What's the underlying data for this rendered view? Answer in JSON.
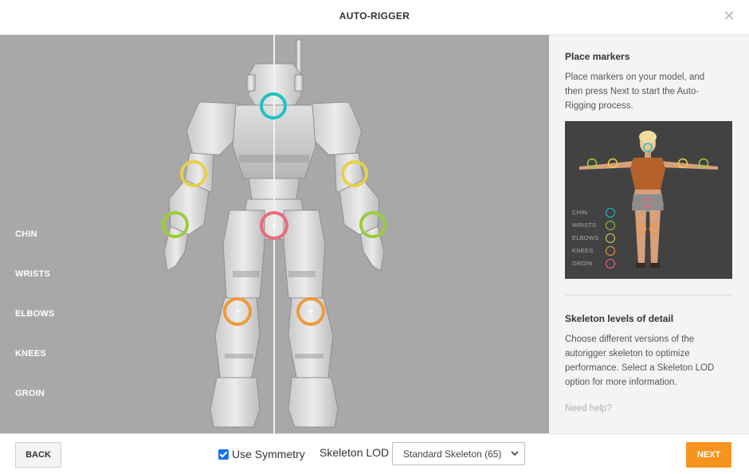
{
  "dialog": {
    "title": "AUTO-RIGGER",
    "close_icon": "close-icon"
  },
  "viewport": {
    "marker_labels": [
      "CHIN",
      "WRISTS",
      "ELBOWS",
      "KNEES",
      "GROIN"
    ],
    "marker_colors": {
      "chin": "#1ec2c4",
      "wrists": "#98cd3a",
      "elbows": "#e6d04a",
      "knees": "#f0993c",
      "groin": "#eb6a7d"
    }
  },
  "panel": {
    "place_markers_title": "Place markers",
    "place_markers_text": "Place markers on your model, and then press Next to start the Auto-Rigging process.",
    "legend": [
      "CHIN",
      "WRISTS",
      "ELBOWS",
      "KNEES",
      "GROIN"
    ],
    "lod_title": "Skeleton levels of detail",
    "lod_text": "Choose different versions of the autorigger skeleton to optimize performance. Select a Skeleton LOD option for more information.",
    "help_link": "Need help?"
  },
  "footer": {
    "back_label": "BACK",
    "use_symmetry_label": "Use Symmetry",
    "use_symmetry_checked": true,
    "skeleton_lod_label": "Skeleton LOD",
    "skeleton_lod_value": "Standard Skeleton (65)",
    "next_label": "NEXT"
  },
  "colors": {
    "accent": "#f7941d",
    "viewport_bg": "#a8a8a8",
    "panel_bg": "#f4f4f4",
    "checkbox": "#1a73e8"
  }
}
